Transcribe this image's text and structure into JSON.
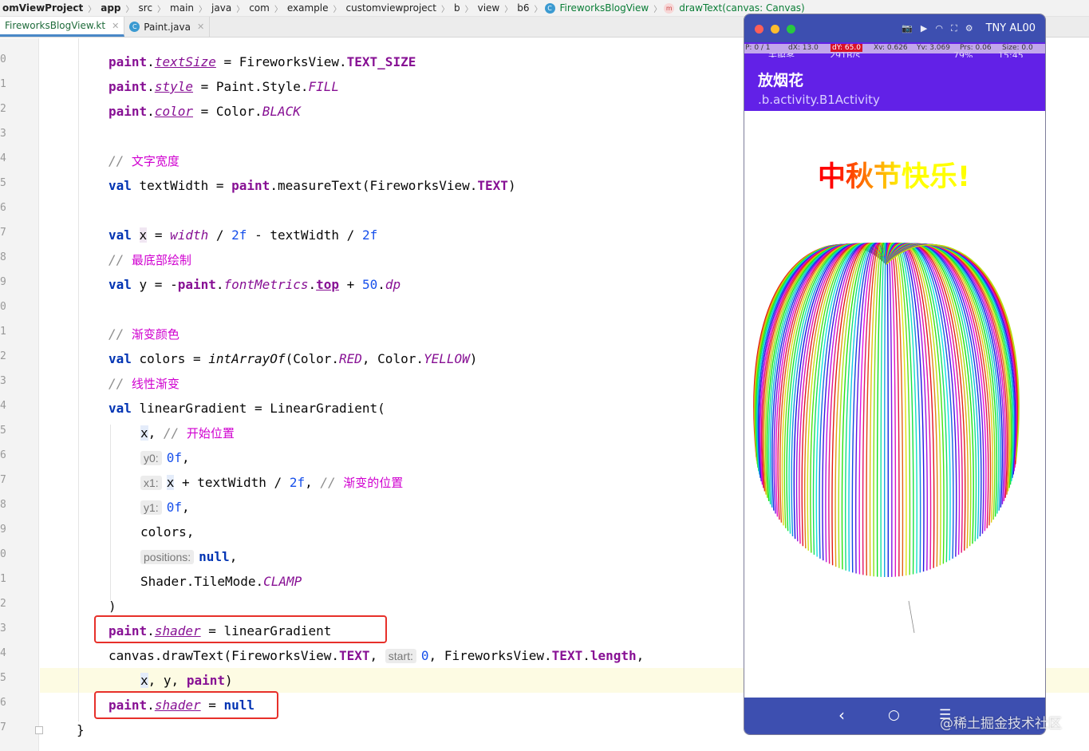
{
  "breadcrumb": {
    "items": [
      "omViewProject",
      "app",
      "src",
      "main",
      "java",
      "com",
      "example",
      "customviewproject",
      "b",
      "view",
      "b6"
    ],
    "class_name": "FireworksBlogView",
    "method_name": "drawText(canvas: Canvas)"
  },
  "tabs": [
    {
      "label": "FireworksBlogView.kt",
      "active": true
    },
    {
      "label": "Paint.java",
      "active": false
    }
  ],
  "editor": {
    "line_numbers": [
      "0",
      "1",
      "2",
      "3",
      "4",
      "5",
      "6",
      "7",
      "8",
      "9",
      "0",
      "1",
      "2",
      "3",
      "4",
      "5",
      "6",
      "7",
      "8",
      "9",
      "0",
      "1",
      "2",
      "3",
      "4",
      "5",
      "6",
      "7"
    ],
    "hints": {
      "y0": "y0:",
      "x1": "x1:",
      "y1": "y1:",
      "positions": "positions:",
      "start": "start:"
    },
    "comments": {
      "text_width": "文字宽度",
      "bottom_draw": "最底部绘制",
      "gradient_color": "渐变颜色",
      "linear_gradient": "线性渐变",
      "start_position": "开始位置",
      "gradient_position": "渐变的位置"
    }
  },
  "emulator": {
    "model": "TNY AL00",
    "pointer_bar": {
      "p": "P: 0 / 1",
      "dx": "dX: 13.0",
      "dy": "dY: 65.0",
      "xv": "Xv: 0.626",
      "yv": "Yv: 3.069",
      "prs": "Prs: 0.06",
      "size": "Size: 0.0"
    },
    "status": {
      "carrier": "无服务",
      "speed": "291B/s",
      "battery": "79%",
      "time": "15:45"
    },
    "app_title": "放烟花",
    "activity": ".b.activity.B1Activity",
    "canvas_text": "中秋节快乐!",
    "gradient_colors": [
      "#ff0000",
      "#ffff00"
    ]
  },
  "watermark": "@稀土掘金技术社区"
}
